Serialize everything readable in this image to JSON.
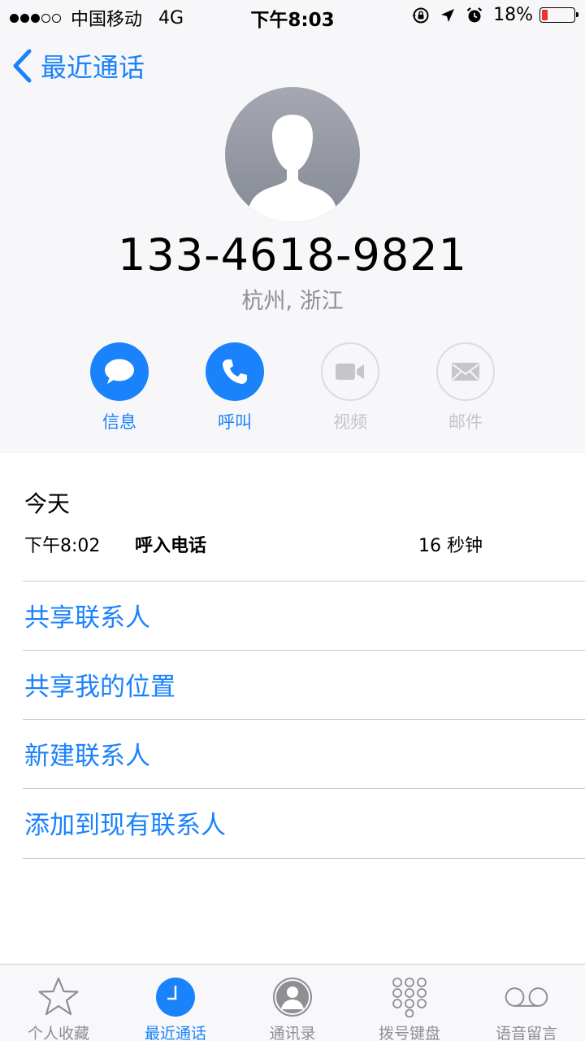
{
  "status_bar": {
    "carrier": "中国移动",
    "network": "4G",
    "time": "下午8:03",
    "battery_percent": "18%",
    "battery_level": 0.18,
    "icons": [
      "rotation-lock-icon",
      "location-arrow-icon",
      "alarm-icon",
      "battery-icon"
    ]
  },
  "nav": {
    "back_label": "最近通话"
  },
  "contact": {
    "phone_number": "133-4618-9821",
    "location": "杭州, 浙江"
  },
  "actions": [
    {
      "label": "信息",
      "icon": "message-icon",
      "enabled": true
    },
    {
      "label": "呼叫",
      "icon": "phone-icon",
      "enabled": true
    },
    {
      "label": "视频",
      "icon": "video-icon",
      "enabled": false
    },
    {
      "label": "邮件",
      "icon": "mail-icon",
      "enabled": false
    }
  ],
  "history": {
    "day": "今天",
    "entries": [
      {
        "time": "下午8:02",
        "type": "呼入电话",
        "duration": "16 秒钟"
      }
    ]
  },
  "menu": [
    {
      "label": "共享联系人"
    },
    {
      "label": "共享我的位置"
    },
    {
      "label": "新建联系人"
    },
    {
      "label": "添加到现有联系人"
    }
  ],
  "tab_bar": {
    "tabs": [
      {
        "label": "个人收藏",
        "icon": "star-icon",
        "active": false
      },
      {
        "label": "最近通话",
        "icon": "clock-icon",
        "active": true
      },
      {
        "label": "通讯录",
        "icon": "contacts-icon",
        "active": false
      },
      {
        "label": "拨号键盘",
        "icon": "keypad-icon",
        "active": false
      },
      {
        "label": "语音留言",
        "icon": "voicemail-icon",
        "active": false
      }
    ]
  },
  "colors": {
    "accent": "#1a82fb",
    "battery_low": "#f2312d",
    "secondary_text": "#8e8e93",
    "disabled": "#c5c5ca",
    "header_bg": "#f7f7f9"
  }
}
